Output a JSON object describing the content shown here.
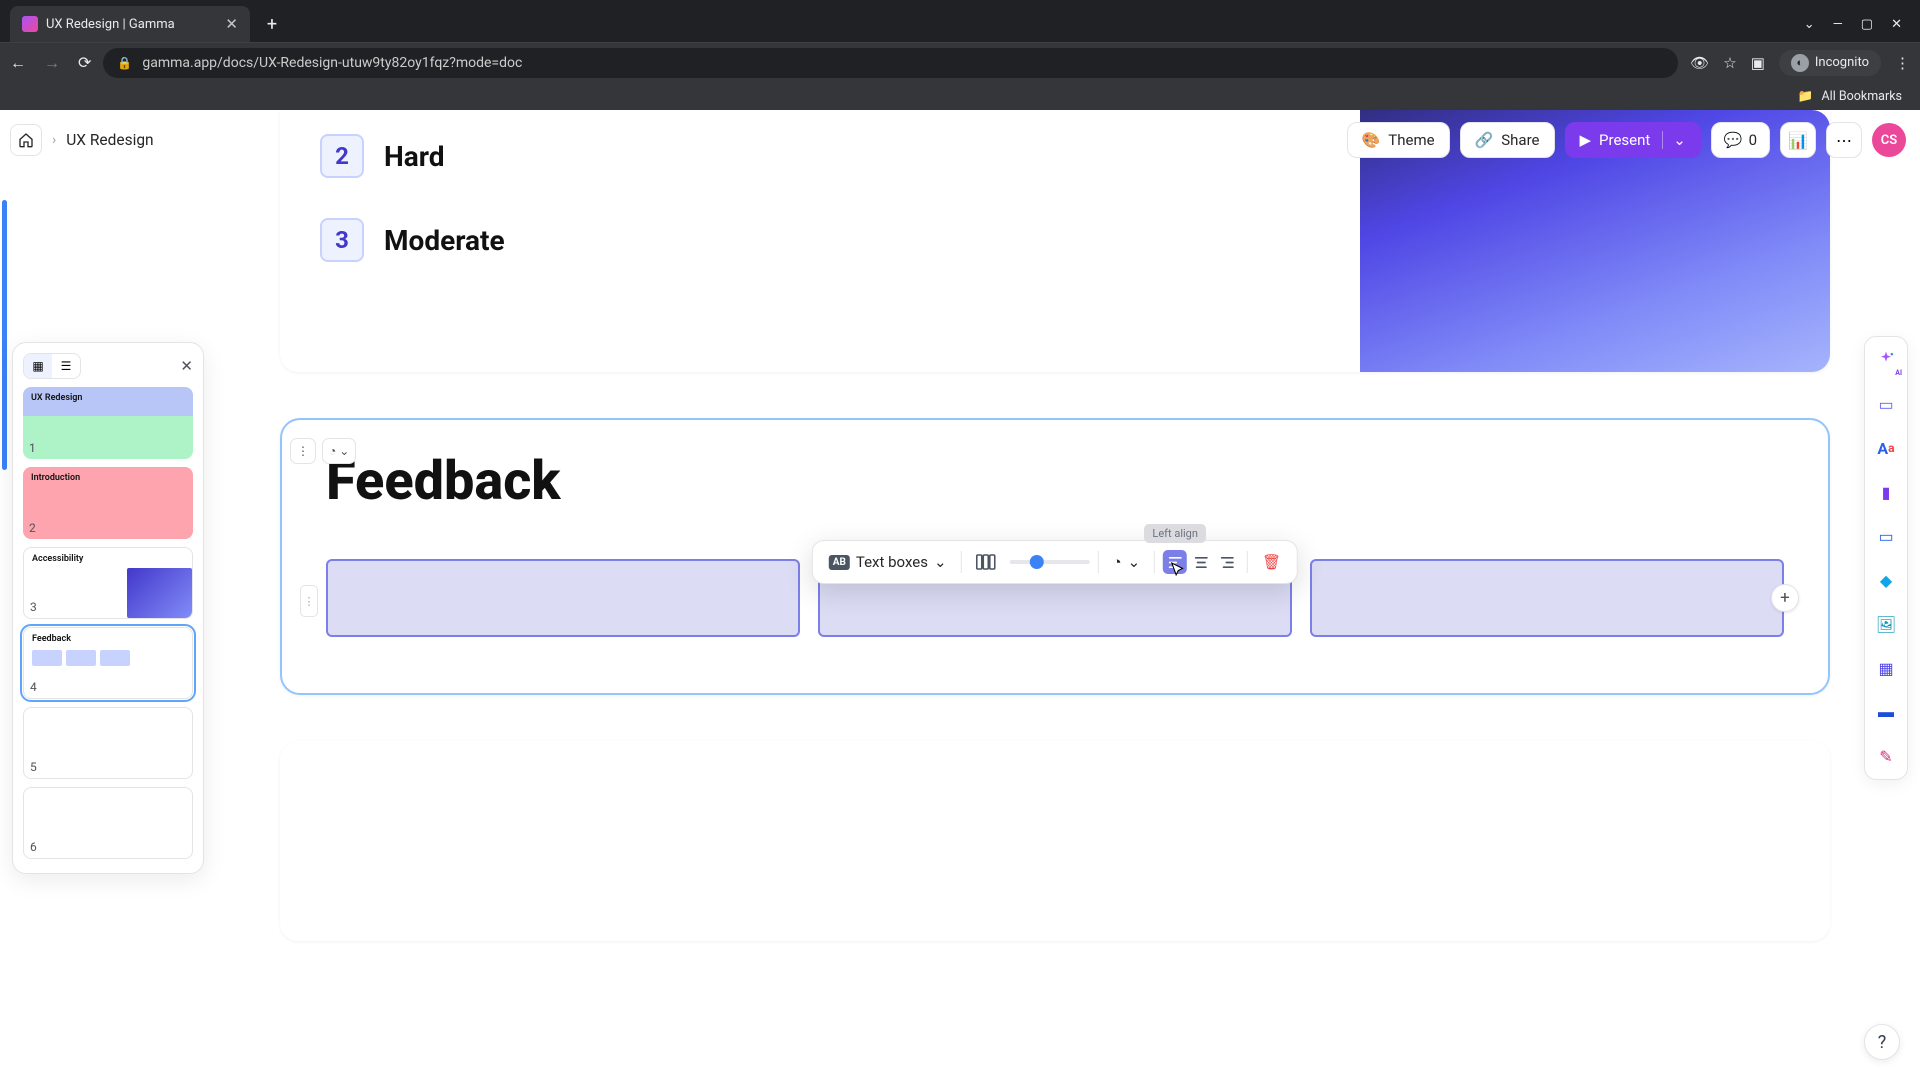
{
  "browser": {
    "tab_title": "UX Redesign | Gamma",
    "url": "gamma.app/docs/UX-Redesign-utuw9ty82oy1fqz?mode=doc",
    "incognito_label": "Incognito",
    "all_bookmarks": "All Bookmarks",
    "window": {
      "dropdown": "⌄",
      "min": "—",
      "max": "▢",
      "close": "✕"
    }
  },
  "topbar": {
    "breadcrumb": "UX Redesign",
    "theme": "Theme",
    "share": "Share",
    "present": "Present",
    "comment_count": "0",
    "avatar": "CS"
  },
  "panel": {
    "thumbs": [
      {
        "num": "1",
        "title": "UX Redesign"
      },
      {
        "num": "2",
        "title": "Introduction"
      },
      {
        "num": "3",
        "title": "Accessibility"
      },
      {
        "num": "4",
        "title": "Feedback"
      },
      {
        "num": "5",
        "title": ""
      },
      {
        "num": "6",
        "title": ""
      }
    ]
  },
  "card1": {
    "steps": [
      {
        "n": "2",
        "label": "Hard"
      },
      {
        "n": "3",
        "label": "Moderate"
      }
    ]
  },
  "card2": {
    "heading": "Feedback",
    "toolbar": {
      "type_label": "Text boxes",
      "tooltip": "Left align"
    }
  }
}
